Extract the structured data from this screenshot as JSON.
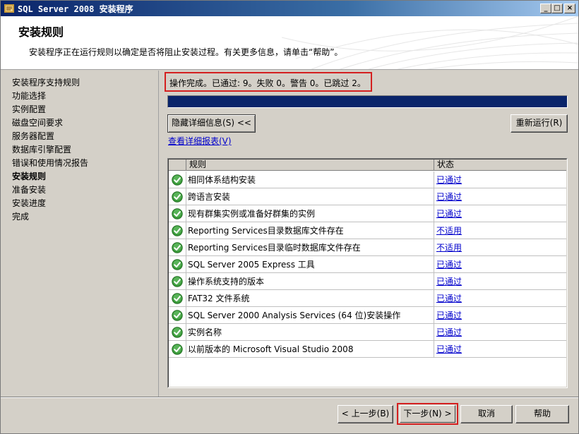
{
  "window": {
    "title": "SQL Server 2008 安装程序",
    "controls": {
      "minimize": "_",
      "maximize": "□",
      "close": "×"
    }
  },
  "header": {
    "title": "安装规则",
    "description": "安装程序正在运行规则以确定是否将阻止安装过程。有关更多信息，请单击“帮助”。"
  },
  "sidebar": {
    "items": [
      {
        "label": "安装程序支持规则",
        "active": false
      },
      {
        "label": "功能选择",
        "active": false
      },
      {
        "label": "实例配置",
        "active": false
      },
      {
        "label": "磁盘空间要求",
        "active": false
      },
      {
        "label": "服务器配置",
        "active": false
      },
      {
        "label": "数据库引擎配置",
        "active": false
      },
      {
        "label": "错误和使用情况报告",
        "active": false
      },
      {
        "label": "安装规则",
        "active": true
      },
      {
        "label": "准备安装",
        "active": false
      },
      {
        "label": "安装进度",
        "active": false
      },
      {
        "label": "完成",
        "active": false
      }
    ]
  },
  "main": {
    "status_text": "操作完成。已通过: 9。失败 0。警告 0。已跳过 2。",
    "progress_fraction": 1.0,
    "hide_details_label": "隐藏详细信息(S) <<",
    "rerun_label": "重新运行(R)",
    "view_report_link": "查看详细报表(V)",
    "grid": {
      "columns": [
        "规则",
        "状态"
      ],
      "rows": [
        {
          "rule": "相同体系结构安装",
          "status": "已通过"
        },
        {
          "rule": "跨语言安装",
          "status": "已通过"
        },
        {
          "rule": "现有群集实例或准备好群集的实例",
          "status": "已通过"
        },
        {
          "rule": "Reporting Services目录数据库文件存在",
          "status": "不适用"
        },
        {
          "rule": "Reporting Services目录临时数据库文件存在",
          "status": "不适用"
        },
        {
          "rule": "SQL Server 2005 Express 工具",
          "status": "已通过"
        },
        {
          "rule": "操作系统支持的版本",
          "status": "已通过"
        },
        {
          "rule": "FAT32 文件系统",
          "status": "已通过"
        },
        {
          "rule": "SQL Server 2000 Analysis Services (64 位)安装操作",
          "status": "已通过"
        },
        {
          "rule": "实例名称",
          "status": "已通过"
        },
        {
          "rule": "以前版本的 Microsoft Visual Studio 2008",
          "status": "已通过"
        }
      ],
      "row_icon": "check-circle-icon"
    }
  },
  "footer": {
    "back_label": "< 上一步(B)",
    "next_label": "下一步(N) >",
    "cancel_label": "取消",
    "help_label": "帮助"
  },
  "colors": {
    "titlebar_start": "#0a246a",
    "progress": "#0a246a",
    "highlight_border": "#d42020",
    "link": "#0000cc",
    "check_green": "#3a9a3a"
  }
}
